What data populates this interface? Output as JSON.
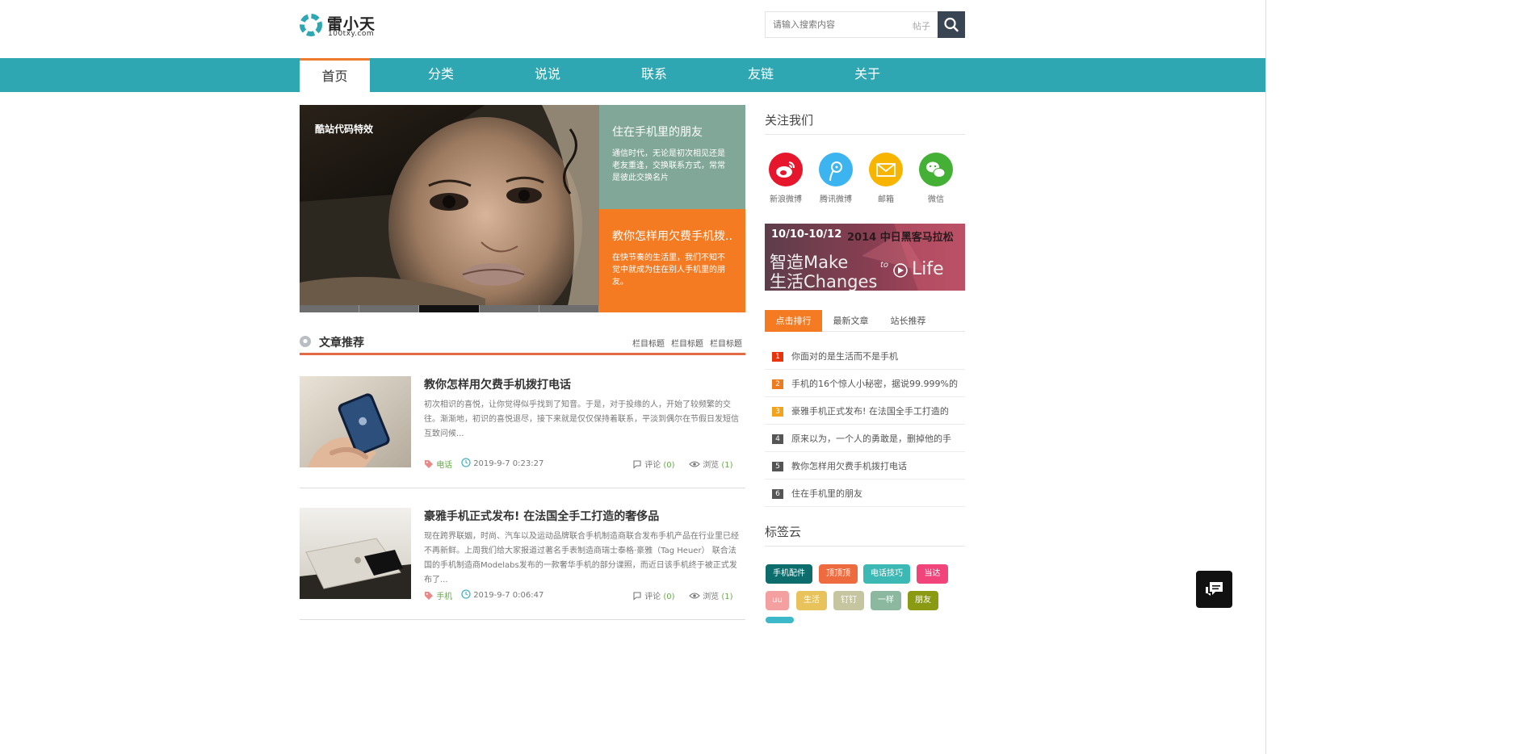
{
  "header": {
    "logo_name": "雷小天",
    "logo_sub": "100txy.com",
    "search_placeholder": "请输入搜索内容",
    "search_scope": "帖子"
  },
  "nav": {
    "items": [
      "首页",
      "分类",
      "说说",
      "联系",
      "友链",
      "关于"
    ],
    "active_index": 0
  },
  "slider": {
    "caption": "酷站代码特效",
    "dots_count": 5,
    "active_dot": 2,
    "panels": [
      {
        "title": "住在手机里的朋友",
        "text": "通信时代，无论是初次相见还是老友重逢，交换联系方式，常常是彼此交换名片"
      },
      {
        "title": "教你怎样用欠费手机拨...",
        "text": "在快节奏的生活里，我们不知不觉中就成为住在别人手机里的朋友。"
      }
    ]
  },
  "section": {
    "title": "文章推荐",
    "links": [
      "栏目标题",
      "栏目标题",
      "栏目标题"
    ]
  },
  "articles": [
    {
      "title": "教你怎样用欠费手机拨打电话",
      "desc": "初次相识的喜悦，让你觉得似乎找到了知音。于是，对于投缘的人，开始了较频繁的交往。渐渐地，初识的喜悦退尽，接下来就是仅仅保持着联系，平淡到偶尔在节假日发短信互致问候...",
      "tag": "电话",
      "time": "2019-9-7 0:23:27",
      "comment_label": "评论",
      "comments": "(0)",
      "view_label": "浏览",
      "views": "(1)"
    },
    {
      "title": "豪雅手机正式发布! 在法国全手工打造的奢侈品",
      "desc": "现在跨界联姻，时尚、汽车以及运动品牌联合手机制造商联合发布手机产品在行业里已经不再新鲜。上周我们给大家报道过著名手表制造商瑞士泰格·豪雅（Tag Heuer） 联合法国的手机制造商Modelabs发布的一款奢华手机的部分谍照，而近日该手机终于被正式发布了...",
      "tag": "手机",
      "time": "2019-9-7 0:06:47",
      "comment_label": "评论",
      "comments": "(0)",
      "view_label": "浏览",
      "views": "(1)"
    }
  ],
  "sidebar": {
    "follow_title": "关注我们",
    "social": [
      {
        "label": "新浪微博",
        "color": "#e6162d",
        "icon": "weibo-icon"
      },
      {
        "label": "腾讯微博",
        "color": "#3cb4ef",
        "icon": "tencent-weibo-icon"
      },
      {
        "label": "邮箱",
        "color": "#f8b500",
        "icon": "mail-icon"
      },
      {
        "label": "微信",
        "color": "#44b035",
        "icon": "wechat-icon"
      }
    ],
    "banner": {
      "date": "10/10-10/12",
      "event": "2014 中日黑客马拉松",
      "line1": "智造Make",
      "line2": "生活Changes",
      "to": "to",
      "life": "Life"
    },
    "tabs": [
      "点击排行",
      "最新文章",
      "站长推荐"
    ],
    "active_tab": 0,
    "ranking": [
      {
        "num": "1",
        "title": "你面对的是生活而不是手机",
        "color": "#e8340d"
      },
      {
        "num": "2",
        "title": "手机的16个惊人小秘密，据说99.999%的",
        "color": "#f07b1f"
      },
      {
        "num": "3",
        "title": "豪雅手机正式发布! 在法国全手工打造的",
        "color": "#f2a31b"
      },
      {
        "num": "4",
        "title": "原来以为，一个人的勇敢是，删掉他的手",
        "color": "#555555"
      },
      {
        "num": "5",
        "title": "教你怎样用欠费手机拨打电话",
        "color": "#555555"
      },
      {
        "num": "6",
        "title": "住在手机里的朋友",
        "color": "#555555"
      }
    ],
    "tags_title": "标签云",
    "tags": [
      {
        "label": "手机配件",
        "color": "#0d6d6d"
      },
      {
        "label": "顶顶顶",
        "color": "#ee6b3f"
      },
      {
        "label": "电话技巧",
        "color": "#3cb8b5"
      },
      {
        "label": "当达",
        "color": "#f0447a"
      },
      {
        "label": "uu",
        "color": "#f4a0a0"
      },
      {
        "label": "生活",
        "color": "#e8c25a"
      },
      {
        "label": "钉钉",
        "color": "#c5c5a0"
      },
      {
        "label": "一样",
        "color": "#8cb8a0"
      },
      {
        "label": "朋友",
        "color": "#8a9a12"
      }
    ]
  }
}
